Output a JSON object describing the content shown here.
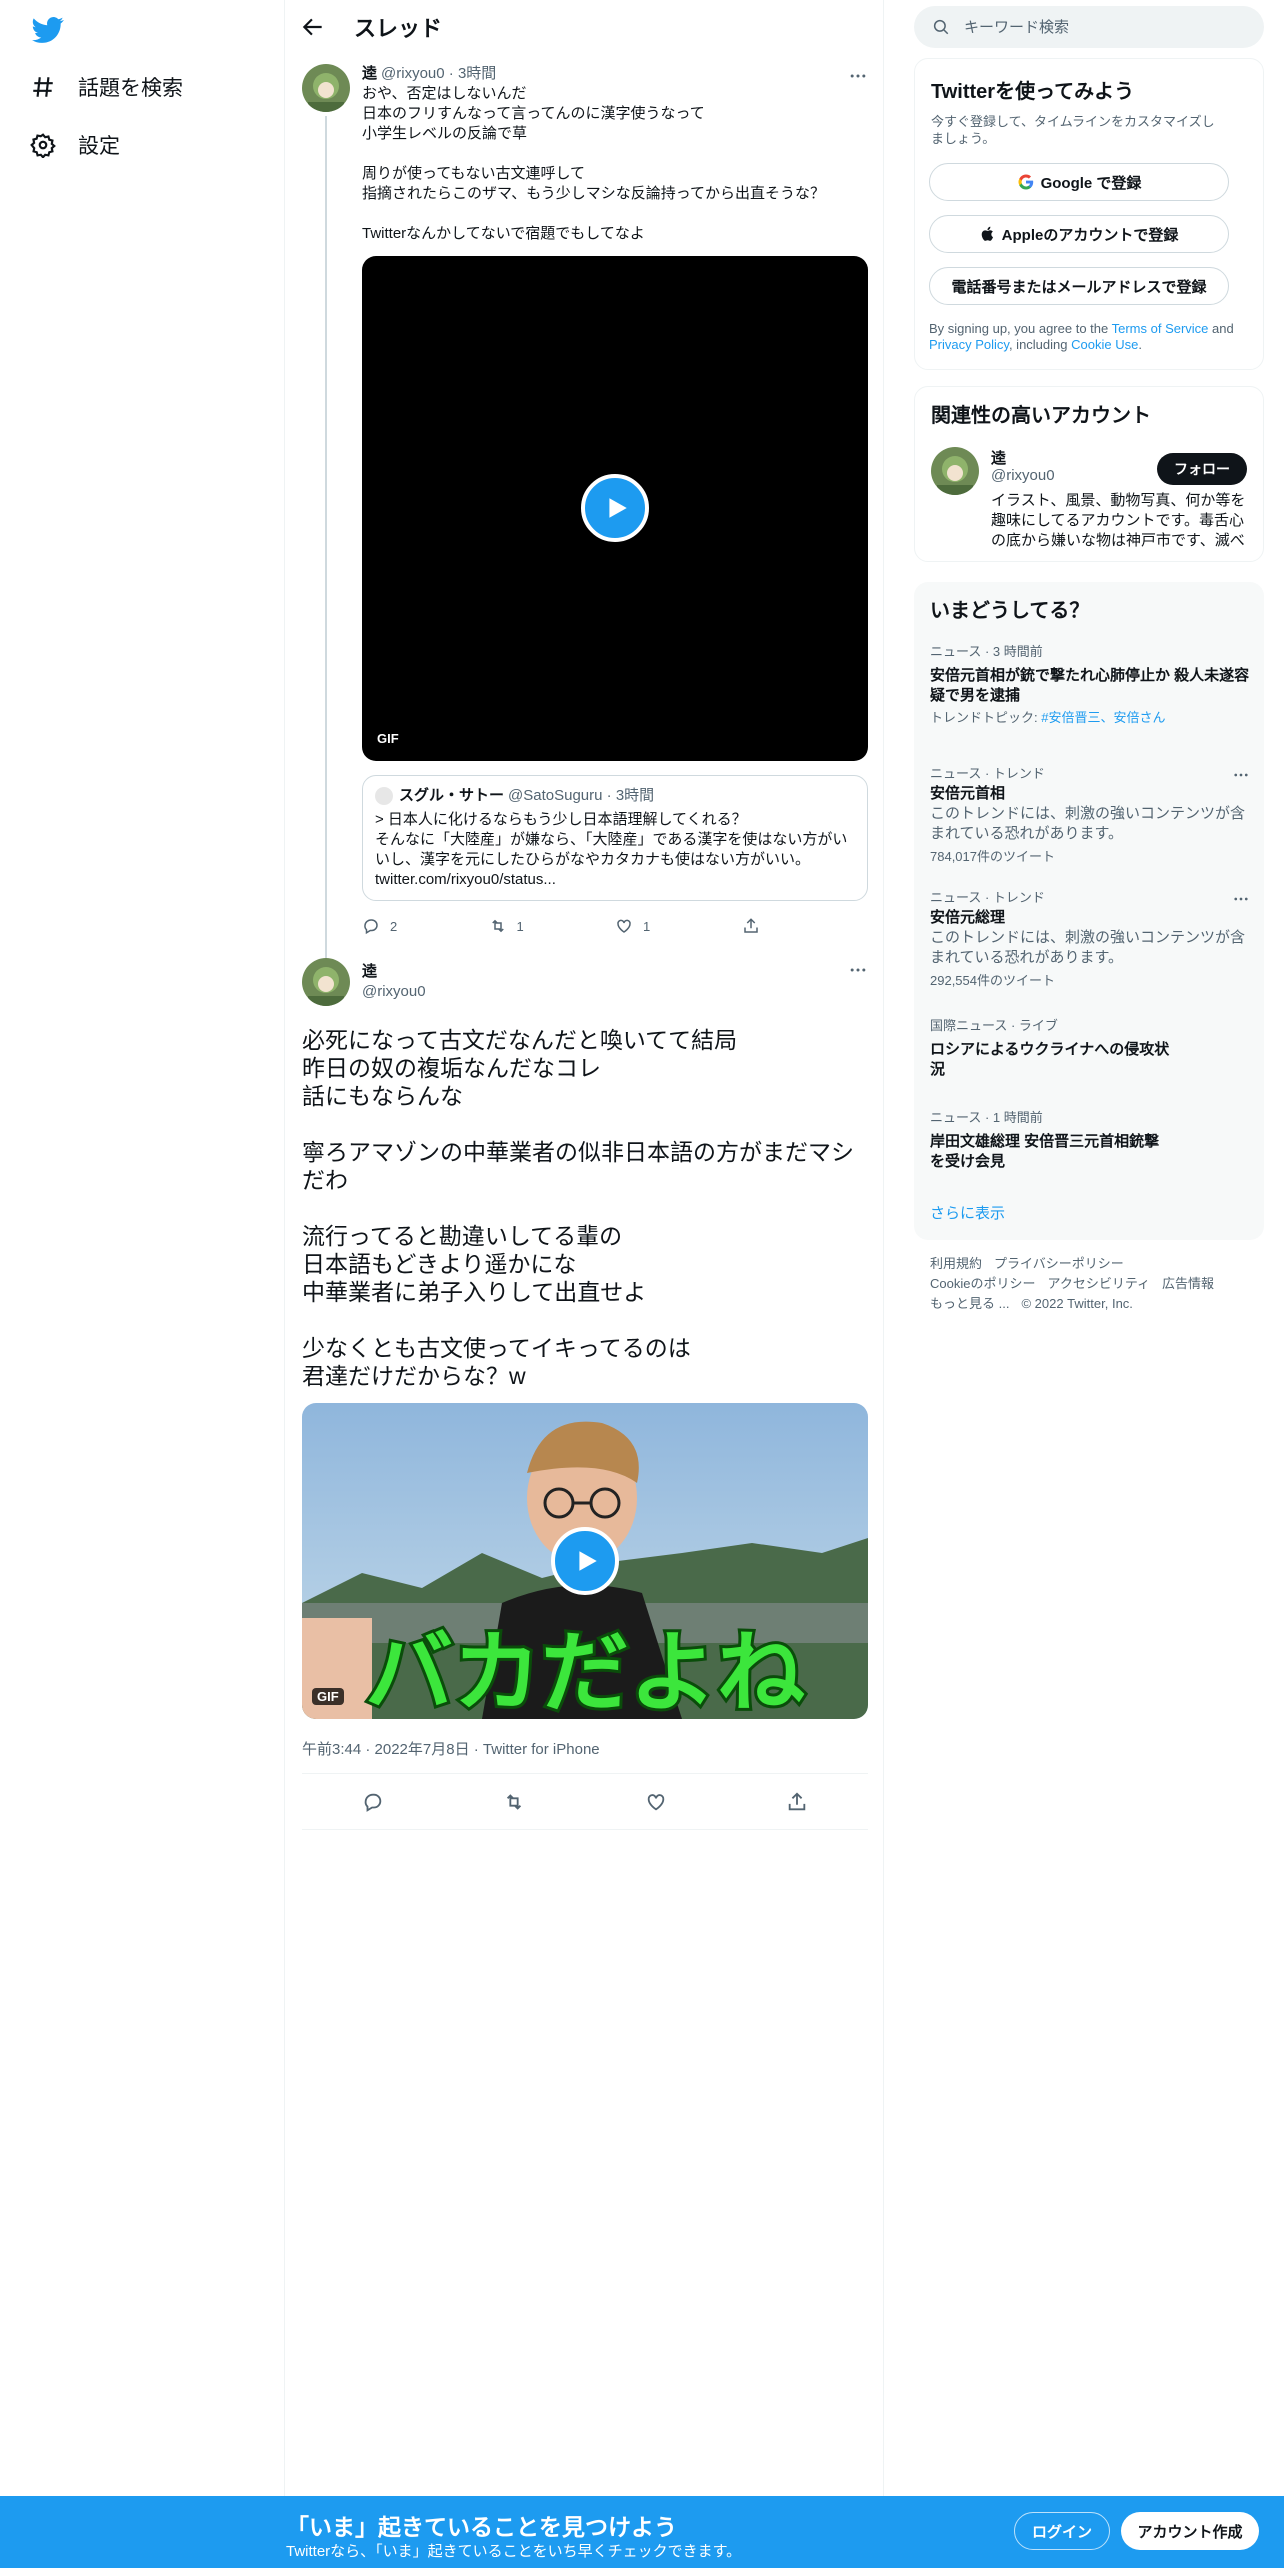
{
  "nav": {
    "explore_label": "話題を検索",
    "settings_label": "設定"
  },
  "header": {
    "title": "スレッド"
  },
  "tweet1": {
    "name": "逵",
    "handle": "@rixyou0",
    "time": "3時間",
    "text": "おや、否定はしないんだ\n日本のフリすんなって言ってんのに漢字使うなって\n小学生レベルの反論で草\n\n周りが使ってもない古文連呼して\n指摘されたらこのザマ、もう少しマシな反論持ってから出直そうな？\n\nTwitterなんかしてないで宿題でもしてなよ",
    "video_badge": "GIF",
    "quote": {
      "name": "スグル・サトー",
      "handle": "@SatoSuguru",
      "time": "3時間",
      "text": "> 日本人に化けるならもう少し日本語理解してくれる？\nそんなに「大陸産」が嫌なら、「大陸産」である漢字を使はない方がいいし、漢字を元にしたひらがなやカタカナも使はない方がいい。\ntwitter.com/rixyou0/status..."
    },
    "replies": "2",
    "retweets": "1",
    "likes": "1"
  },
  "tweet2": {
    "name": "逵",
    "handle": "@rixyou0",
    "text": "必死になって古文だなんだと喚いてて結局\n昨日の奴の複垢なんだなコレ\n話にもならんな\n\n寧ろアマゾンの中華業者の似非日本語の方がまだマシだわ\n\n流行ってると勘違いしてる輩の\n日本語もどきより遥かにな\n中華業者に弟子入りして出直せよ\n\n少なくとも古文使ってイキってるのは\n君達だけだからな？w",
    "video_badge": "GIF",
    "video_caption": "バカだよね",
    "timestamp": "午前3:44 · 2022年7月8日 · Twitter for iPhone"
  },
  "search": {
    "placeholder": "キーワード検索"
  },
  "signup_card": {
    "title": "Twitterを使ってみよう",
    "subtitle": "今すぐ登録して、タイムラインをカスタマイズしましょう。",
    "google_label": "Google で登録",
    "apple_label": "Appleのアカウントで登録",
    "phone_label": "電話番号またはメールアドレスで登録",
    "legal_prefix": "By signing up, you agree to the ",
    "terms": "Terms of Service",
    "and": " and ",
    "privacy": "Privacy Policy",
    "including": ", including ",
    "cookie": "Cookie Use",
    "period": "."
  },
  "related": {
    "title": "関連性の高いアカウント",
    "name": "逵",
    "handle": "@rixyou0",
    "bio": "イラスト、風景、動物写真、何か等を趣味にしてるアカウントです。毒舌心の底から嫌いな物は神戸市です、滅べ",
    "follow_label": "フォロー"
  },
  "trends": {
    "title": "いまどうしてる？",
    "items": [
      {
        "category": "ニュース · 3 時間前",
        "title": "安倍元首相が銃で撃たれ心肺停止か 殺人未遂容疑で男を逮捕",
        "topic_prefix": "トレンドトピック: ",
        "topic_links": "#安倍晋三、安倍さん"
      },
      {
        "category": "ニュース · トレンド",
        "title": "安倍元首相",
        "desc": "このトレンドには、刺激の強いコンテンツが含まれている恐れがあります。",
        "count": "784,017件のツイート"
      },
      {
        "category": "ニュース · トレンド",
        "title": "安倍元総理",
        "desc": "このトレンドには、刺激の強いコンテンツが含まれている恐れがあります。",
        "count": "292,554件のツイート"
      },
      {
        "category": "国際ニュース · ライブ",
        "title": "ロシアによるウクライナへの侵攻状況"
      },
      {
        "category": "ニュース · 1 時間前",
        "title": "岸田文雄総理 安倍晋三元首相銃撃を受け会見"
      }
    ],
    "show_more": "さらに表示"
  },
  "footer": {
    "links": [
      "利用規約",
      "プライバシーポリシー",
      "Cookieのポリシー",
      "アクセシビリティ",
      "広告情報",
      "もっと見る ..."
    ],
    "copyright": "© 2022 Twitter, Inc."
  },
  "bottom_bar": {
    "title": "「いま」起きていることを見つけよう",
    "subtitle": "Twitterなら、「いま」起きていることをいち早くチェックできます。",
    "login_label": "ログイン",
    "signup_label": "アカウント作成"
  },
  "colors": {
    "accent": "#1d9bf0",
    "text": "#0f1419",
    "muted": "#536471",
    "border": "#eff3f4"
  }
}
